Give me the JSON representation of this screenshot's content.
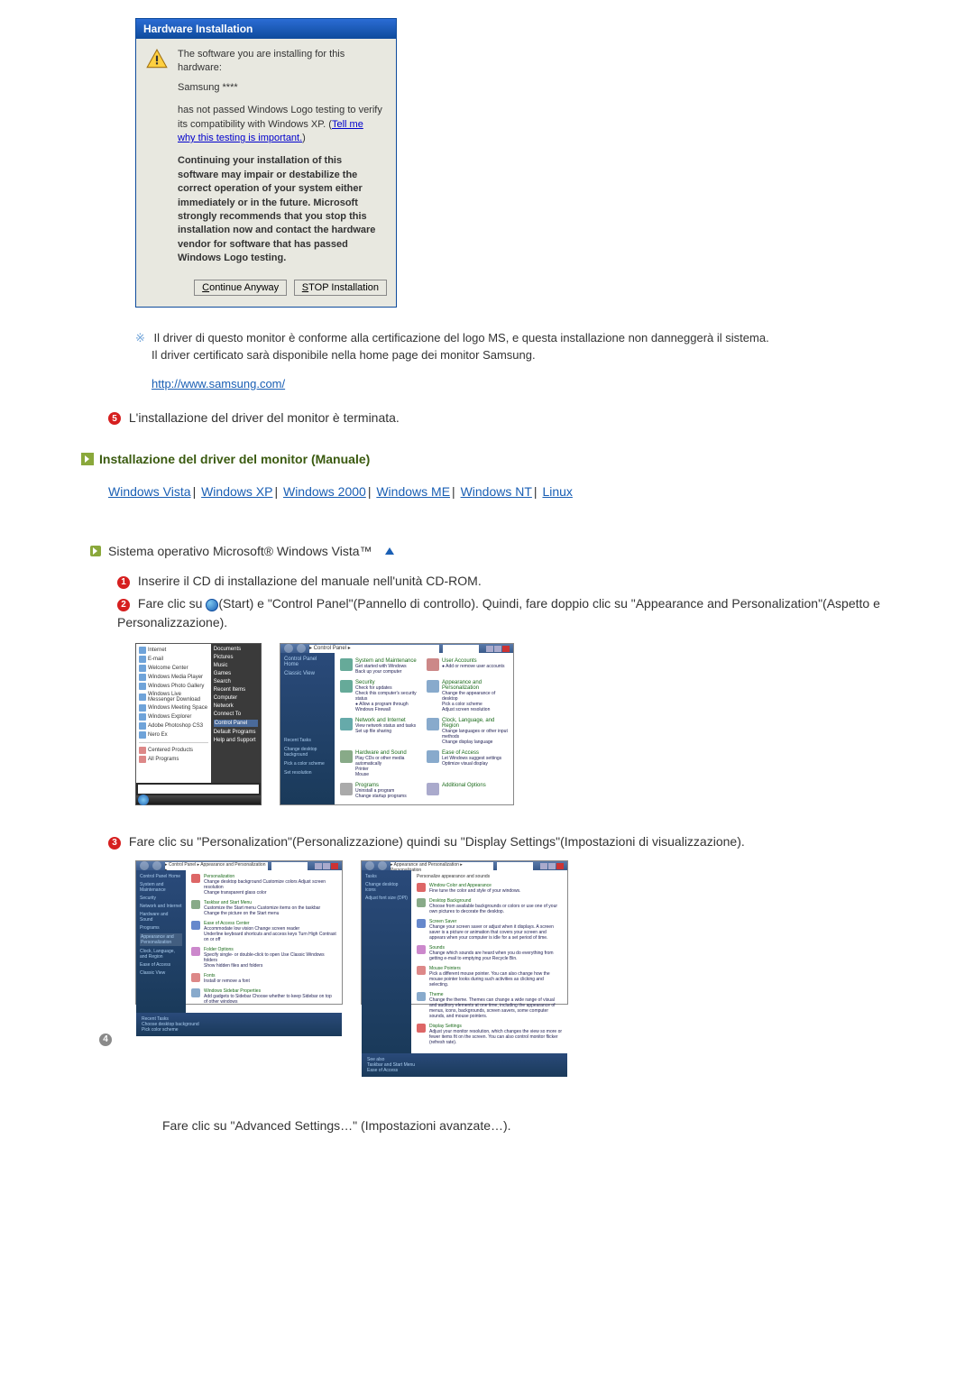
{
  "dialog": {
    "title": "Hardware Installation",
    "line1": "The software you are installing for this hardware:",
    "device": "Samsung ****",
    "line2a": "has not passed Windows Logo testing to verify its compatibility with Windows XP. (",
    "link": "Tell me why this testing is important.",
    "line2b": ")",
    "warn": "Continuing your installation of this software may impair or destabilize the correct operation of your system either immediately or in the future. Microsoft strongly recommends that you stop this installation now and contact the hardware vendor for software that has passed Windows Logo testing.",
    "btn_continue": "Continue Anyway",
    "btn_stop": "STOP Installation"
  },
  "note": {
    "mark": "※",
    "text1": "Il driver di questo monitor è conforme alla certificazione del logo MS, e questa installazione non danneggerà il sistema.",
    "text2": "Il driver certificato sarà disponibile nella home page dei monitor Samsung.",
    "url": "http://www.samsung.com/"
  },
  "step5": "L'installazione del driver del monitor è terminata.",
  "section_manual": "Installazione del driver del monitor (Manuale)",
  "os": {
    "vista": "Windows Vista",
    "xp": "Windows XP",
    "w2000": "Windows 2000",
    "me": "Windows ME",
    "nt": "Windows NT",
    "linux": "Linux"
  },
  "sub_head": "Sistema operativo Microsoft® Windows Vista™",
  "steps": {
    "s1": "Inserire il CD di installazione del manuale nell'unità CD-ROM.",
    "s2a": "Fare clic su ",
    "s2b": "(Start) e \"Control Panel\"(Pannello di controllo). Quindi, fare doppio clic su \"Appearance and Personalization\"(Aspetto e Personalizzazione).",
    "s3": "Fare clic su \"Personalization\"(Personalizzazione) quindi su \"Display Settings\"(Impostazioni di visualizzazione).",
    "s4": "Fare clic su \"Advanced Settings…\" (Impostazioni avanzate…)."
  },
  "vista_start": {
    "items": [
      "Internet",
      "E-mail",
      "Welcome Center",
      "Windows Media Player",
      "Windows Photo Gallery",
      "Windows Live Messenger Download",
      "Windows Meeting Space",
      "Windows Explorer",
      "Adobe Photoshop CS3",
      "Nero Ex"
    ],
    "bottom": [
      "Centered Products",
      "All Programs"
    ],
    "right": [
      "Documents",
      "Pictures",
      "Music",
      "Games",
      "Search",
      "Recent Items",
      "Computer",
      "Network",
      "Connect To",
      "Control Panel",
      "Default Programs",
      "Help and Support"
    ]
  },
  "vista_cp": {
    "addr": "▸ Control Panel ▸",
    "side": [
      "Control Panel Home",
      "Classic View"
    ],
    "side_bottom": [
      "Recent Tasks",
      "Change desktop background",
      "Pick a color scheme",
      "Set resolution"
    ],
    "cats": [
      {
        "t": "System and Maintenance",
        "s": "Get started with Windows\nBack up your computer",
        "c": "#6a9"
      },
      {
        "t": "User Accounts",
        "s": "● Add or remove user accounts",
        "c": "#c88"
      },
      {
        "t": "Security",
        "s": "Check for updates\nCheck this computer's security status\n● Allow a program through Windows Firewall",
        "c": "#6a9"
      },
      {
        "t": "Appearance and Personalization",
        "s": "Change the appearance of desktop\nPick a color scheme\nAdjust screen resolution",
        "c": "#8ac"
      },
      {
        "t": "Network and Internet",
        "s": "View network status and tasks\nSet up file sharing",
        "c": "#6aa"
      },
      {
        "t": "Clock, Language, and Region",
        "s": "Change languages or other input methods\nChange display language",
        "c": "#8ac"
      },
      {
        "t": "Hardware and Sound",
        "s": "Play CDs or other media automatically\nPrinter\nMouse",
        "c": "#8a8"
      },
      {
        "t": "Ease of Access",
        "s": "Let Windows suggest settings\nOptimize visual display",
        "c": "#8ac"
      },
      {
        "t": "Programs",
        "s": "Uninstall a program\nChange startup programs",
        "c": "#aaa"
      },
      {
        "t": "Additional Options",
        "s": "",
        "c": "#aac"
      }
    ]
  },
  "vista_ap1": {
    "addr": "▸ Control Panel ▸ Appearance and Personalization ▸",
    "side": [
      "Control Panel Home",
      "System and Maintenance",
      "Security",
      "Network and Internet",
      "Hardware and Sound",
      "Programs",
      "Appearance and Personalization",
      "Clock, Language, and Region",
      "Ease of Access",
      "Classic View"
    ],
    "side_bottom": [
      "Recent Tasks",
      "Choose desktop background",
      "Pick color scheme"
    ],
    "items": [
      {
        "t": "Personalization",
        "s": "Change desktop background   Customize colors   Adjust screen resolution\nChange transparent glass color"
      },
      {
        "t": "Taskbar and Start Menu",
        "s": "Customize the Start menu   Customize items on the taskbar\nChange the picture on the Start menu"
      },
      {
        "t": "Ease of Access Center",
        "s": "Accommodate low vision   Change screen reader\nUnderline keyboard shortcuts and access keys   Turn High Contrast on or off"
      },
      {
        "t": "Folder Options",
        "s": "Specify single- or double-click to open   Use Classic Windows folders\nShow hidden files and folders"
      },
      {
        "t": "Fonts",
        "s": "Install or remove a font"
      },
      {
        "t": "Windows Sidebar Properties",
        "s": "Add gadgets to Sidebar   Choose whether to keep Sidebar on top of other windows"
      }
    ]
  },
  "vista_ap2": {
    "addr": "▸ Appearance and Personalization ▸ Personalization",
    "side": [
      "Tasks",
      "Change desktop icons",
      "Adjust font size (DPI)"
    ],
    "side_bottom": [
      "See also",
      "Taskbar and Start Menu",
      "Ease of Access"
    ],
    "heading": "Personalize appearance and sounds",
    "items": [
      {
        "t": "Window Color and Appearance",
        "s": "Fine tune the color and style of your windows."
      },
      {
        "t": "Desktop Background",
        "s": "Choose from available backgrounds or colors or use one of your own pictures to decorate the desktop."
      },
      {
        "t": "Screen Saver",
        "s": "Change your screen saver or adjust when it displays. A screen saver is a picture or animation that covers your screen and appears when your computer is idle for a set period of time."
      },
      {
        "t": "Sounds",
        "s": "Change which sounds are heard when you do everything from getting e-mail to emptying your Recycle Bin."
      },
      {
        "t": "Mouse Pointers",
        "s": "Pick a different mouse pointer. You can also change how the mouse pointer looks during such activities as clicking and selecting."
      },
      {
        "t": "Theme",
        "s": "Change the theme. Themes can change a wide range of visual and auditory elements at one time, including the appearance of menus, icons, backgrounds, screen savers, some computer sounds, and mouse pointers."
      },
      {
        "t": "Display Settings",
        "s": "Adjust your monitor resolution, which changes the view so more or fewer items fit on the screen. You can also control monitor flicker (refresh rate)."
      }
    ]
  }
}
